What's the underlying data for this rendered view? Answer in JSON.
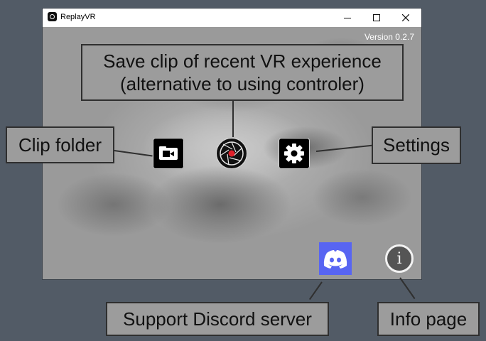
{
  "window": {
    "title": "ReplayVR",
    "controls": {
      "minimize": "–",
      "maximize": "☐",
      "close": "✕"
    }
  },
  "main": {
    "version": "Version 0.2.7",
    "buttons": {
      "clip_folder_icon": "folder-video-icon",
      "record_icon": "camera-shutter-icon",
      "settings_icon": "gear-icon",
      "discord_icon": "discord-icon",
      "info_icon": "info-icon",
      "info_glyph": "i"
    }
  },
  "callouts": {
    "save_clip_line1": "Save clip of recent VR experience",
    "save_clip_line2": "(alternative to using controler)",
    "clip_folder": "Clip folder",
    "settings": "Settings",
    "discord": "Support Discord server",
    "info": "Info page"
  },
  "colors": {
    "desktop": "#525b66",
    "callout_bg": "#9c9c9c",
    "discord": "#5865f2",
    "record_dot": "#e0202a"
  }
}
